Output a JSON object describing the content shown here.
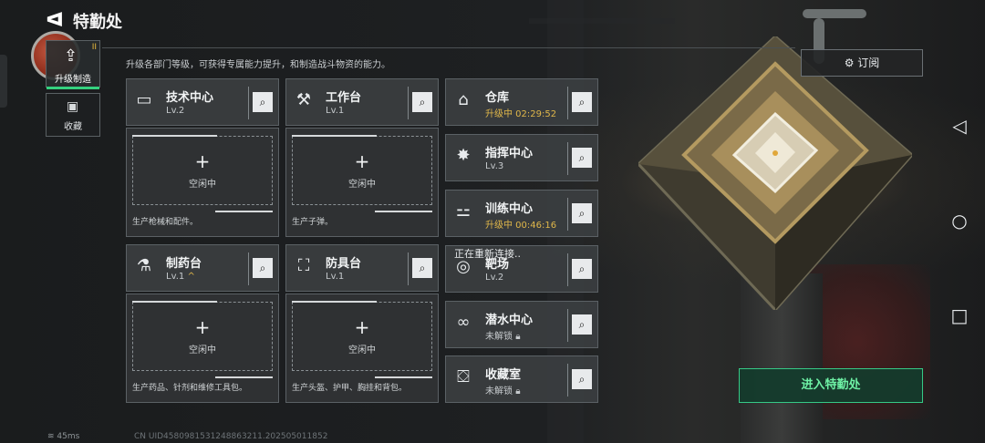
{
  "header": {
    "back_glyph": "ᐊ",
    "title": "特勤处",
    "description": "升级各部门等级，可获得专属能力提升，和制造战斗物资的能力。"
  },
  "nav": {
    "upgrade": {
      "label": "升级制造",
      "icon": "upgrade-icon",
      "pause_mark": "II"
    },
    "collection": {
      "label": "收藏",
      "icon": "vault-icon"
    }
  },
  "departments_left": [
    {
      "name": "技术中心",
      "level": "Lv.2",
      "icon": "computer-icon",
      "slot_idle": "空闲中",
      "slot_desc": "生产枪械和配件。"
    },
    {
      "name": "工作台",
      "level": "Lv.1",
      "icon": "tools-icon",
      "slot_idle": "空闲中",
      "slot_desc": "生产子弹。"
    },
    {
      "name": "制药台",
      "level": "Lv.1",
      "level_mark": "^",
      "icon": "microscope-icon",
      "slot_idle": "空闲中",
      "slot_desc": "生产药品、针剂和维修工具包。"
    },
    {
      "name": "防具台",
      "level": "Lv.1",
      "icon": "armor-icon",
      "slot_idle": "空闲中",
      "slot_desc": "生产头盔、护甲、胸挂和背包。"
    }
  ],
  "departments_right": [
    {
      "name": "仓库",
      "status": "升级中 02:29:52",
      "icon": "warehouse-icon"
    },
    {
      "name": "指挥中心",
      "status": "Lv.3",
      "icon": "command-icon"
    },
    {
      "name": "训练中心",
      "status": "升级中 00:46:16",
      "icon": "dumbbell-icon"
    },
    {
      "name": "靶场",
      "status": "Lv.2",
      "icon": "target-icon"
    },
    {
      "name": "潜水中心",
      "status": "未解锁",
      "icon": "diving-icon"
    },
    {
      "name": "收藏室",
      "status": "未解锁",
      "icon": "collection-room-icon"
    }
  ],
  "reconnect": "正在重新连接..",
  "subscribe": {
    "label": "订阅",
    "icon": "subscribe-icon"
  },
  "enter_button": "进入特勤处",
  "status_bar": {
    "ping": "45ms",
    "uid": "CN UID4580981531248863211.202505011852"
  },
  "colors": {
    "accent_green": "#36c986",
    "upgrading": "#e0b74a",
    "panel": "#3a3d3f"
  }
}
